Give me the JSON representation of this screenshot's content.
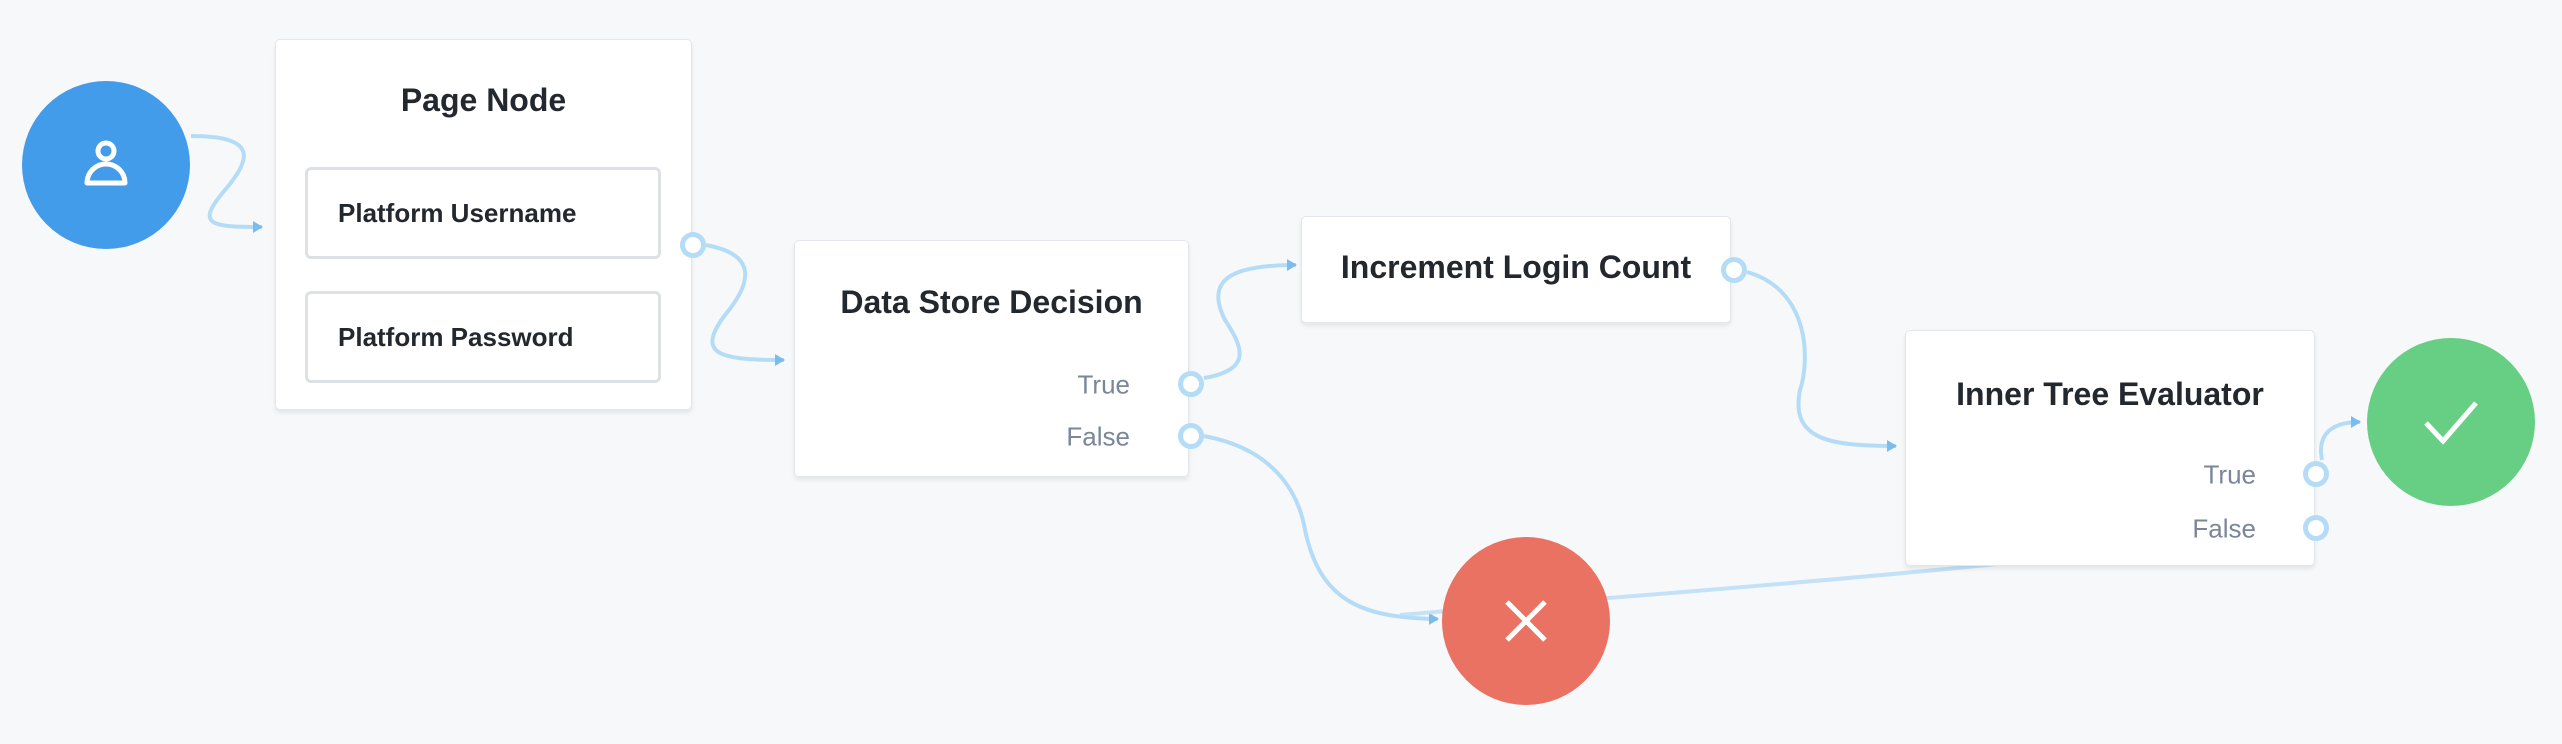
{
  "nodes": {
    "start": {
      "icon": "user-icon",
      "color": "#439ce9"
    },
    "page_node": {
      "title": "Page Node",
      "fields": [
        "Platform Username",
        "Platform Password"
      ]
    },
    "data_store_decision": {
      "title": "Data Store Decision",
      "outcomes": [
        "True",
        "False"
      ]
    },
    "increment_login_count": {
      "title": "Increment Login Count"
    },
    "inner_tree_evaluator": {
      "title": "Inner Tree Evaluator",
      "outcomes": [
        "True",
        "False"
      ]
    },
    "failure": {
      "icon": "x-icon",
      "color": "#e97262"
    },
    "success": {
      "icon": "check-icon",
      "color": "#66cf84"
    }
  },
  "edge_color": "#b5dcf7"
}
